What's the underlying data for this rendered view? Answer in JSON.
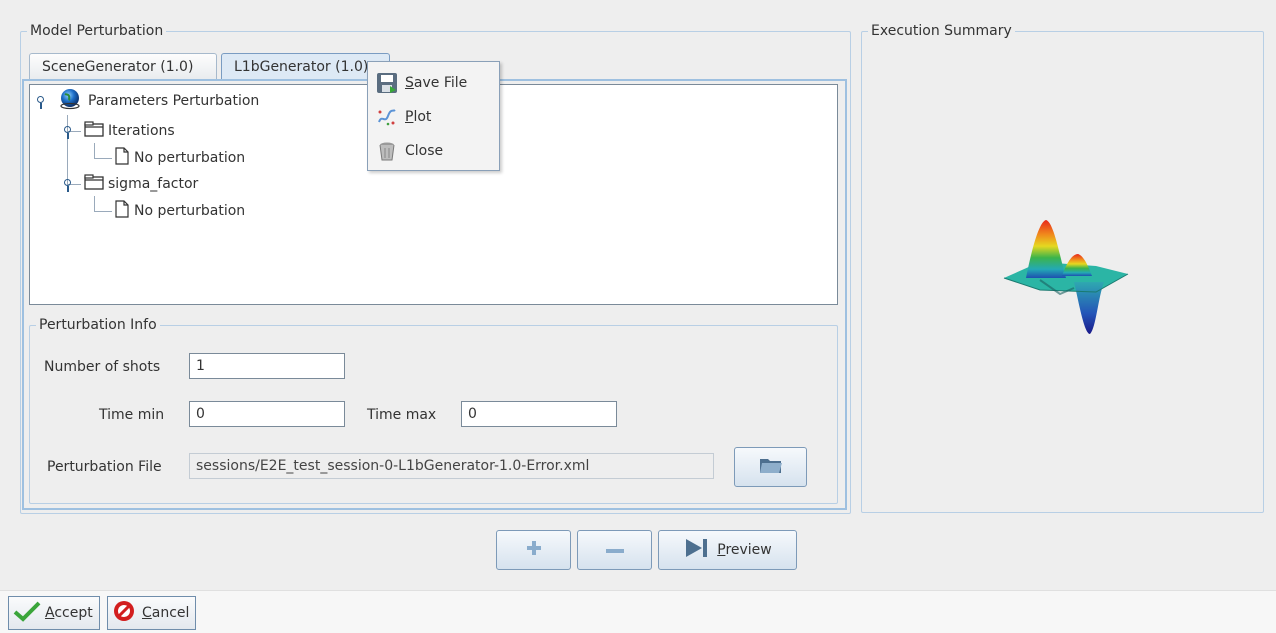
{
  "model_perturbation": {
    "title": "Model Perturbation",
    "tabs": [
      {
        "label": "SceneGenerator (1.0)",
        "active": false
      },
      {
        "label": "L1bGenerator (1.0)",
        "active": true
      }
    ],
    "tree": {
      "root": {
        "label": "Parameters Perturbation",
        "icon": "globe-icon"
      },
      "children": [
        {
          "label": "Iterations",
          "icon": "folder-icon",
          "child": {
            "label": "No perturbation",
            "icon": "file-icon"
          }
        },
        {
          "label": "sigma_factor",
          "icon": "folder-icon",
          "child": {
            "label": "No perturbation",
            "icon": "file-icon"
          }
        }
      ]
    },
    "context_menu": {
      "items": [
        {
          "label": "Save File",
          "mnemonic": "S",
          "rest": "ave File",
          "icon": "save-icon"
        },
        {
          "label": "Plot",
          "mnemonic": "P",
          "rest": "lot",
          "icon": "plot-icon"
        },
        {
          "label": "Close",
          "icon": "trash-icon"
        }
      ]
    },
    "info": {
      "title": "Perturbation Info",
      "number_of_shots_label": "Number of shots",
      "number_of_shots": "1",
      "time_min_label": "Time min",
      "time_min": "0",
      "time_max_label": "Time max",
      "time_max": "0",
      "file_label": "Perturbation File",
      "file_value": "sessions/E2E_test_session-0-L1bGenerator-1.0-Error.xml"
    }
  },
  "execution_summary": {
    "title": "Execution Summary"
  },
  "actions": {
    "add_icon": "plus-icon",
    "remove_icon": "minus-icon",
    "preview_label": "Preview",
    "preview_mnemonic": "P",
    "preview_rest": "review"
  },
  "footer": {
    "accept_label": "Accept",
    "accept_mnemonic": "A",
    "accept_rest": "ccept",
    "cancel_label": "Cancel",
    "cancel_mnemonic": "C",
    "cancel_rest": "ancel"
  },
  "colors": {
    "accent_border": "#9ec0e0",
    "tab_active": "#dde9f5"
  }
}
